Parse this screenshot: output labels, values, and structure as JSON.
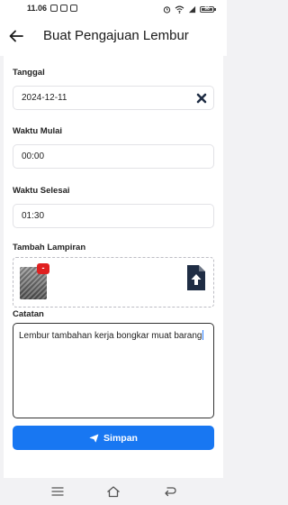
{
  "status_bar": {
    "time": "11.06",
    "battery_level": "96"
  },
  "header": {
    "title": "Buat Pengajuan Lembur"
  },
  "form": {
    "date": {
      "label": "Tanggal",
      "value": "2024-12-11"
    },
    "start_time": {
      "label": "Waktu Mulai",
      "value": "00:00"
    },
    "end_time": {
      "label": "Waktu Selesai",
      "value": "01:30"
    },
    "attachment": {
      "label": "Tambah Lampiran",
      "remove_label": "-"
    },
    "notes": {
      "label": "Catatan",
      "value": "Lembur tambahan kerja bongkar muat barang"
    },
    "save_label": "Simpan"
  },
  "colors": {
    "accent": "#1877f2",
    "danger": "#e02020",
    "icon_dark": "#1f2d44"
  },
  "icons": [
    "arrow-left-icon",
    "close-icon",
    "file-upload-icon",
    "send-icon",
    "menu-icon",
    "home-icon",
    "back-nav-icon"
  ]
}
